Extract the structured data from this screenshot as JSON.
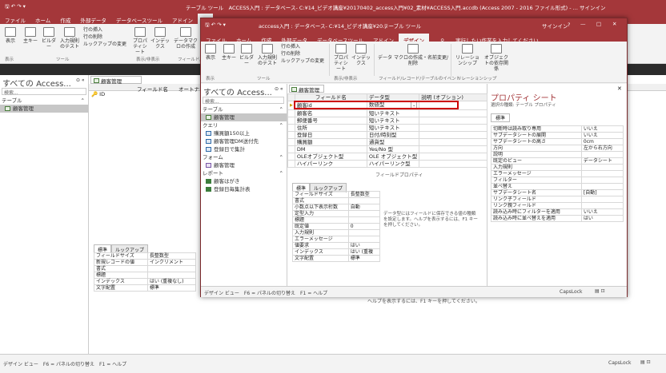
{
  "back": {
    "title": "テーブル ツール　ACCESS入門 : データベース- C:¥14_ビデオ講座¥20170402_access入門¥02_素材¥ACCESS入門.accdb (Access 2007 - 2016 ファイル形式) - ... サインイン",
    "tabs": [
      "ファイル",
      "ホーム",
      "作成",
      "外部データ",
      "データベースツール",
      "アドイン",
      "デ"
    ],
    "ribbon": {
      "view": "表示",
      "primary_key": "主キー",
      "builder": "ビルダー",
      "test_rule": "入力規則のテスト",
      "insert_row": "行の挿入",
      "delete_row": "行の削除",
      "change_lookup": "ルックアップの変更",
      "property_sheet": "プロパティシート",
      "index": "インデックス",
      "macro": "データマクロの作成",
      "group_view": "表示",
      "group_tools": "ツール",
      "group_showhide": "表示/非表示",
      "group_field": "フィールド/"
    },
    "nav_title": "すべての Access...",
    "search_placeholder": "検索...",
    "nav_section": "テーブル",
    "nav_item": "顧客管理",
    "doc_tab": "顧客管理",
    "col_field": "フィールド名",
    "col_type": "オートナ",
    "first_row": "ID",
    "field_props": [
      [
        "フィールドサイズ",
        "長整数型"
      ],
      [
        "新規レコードの値",
        "インクリメント"
      ],
      [
        "書式",
        ""
      ],
      [
        "標題",
        ""
      ],
      [
        "インデックス",
        "はい (重複なし)"
      ],
      [
        "文字配置",
        "標準"
      ]
    ],
    "prop_tabs": [
      "標準",
      "ルックアップ"
    ],
    "status_left": "デザイン ビュー　F6 = パネルの切り替え　F1 = ヘルプ",
    "status_right": "CapsLock",
    "help_text": "ヘルプを表示するには、F1 キーを押してください。"
  },
  "front": {
    "title": "acccess入門 : データベース- C:¥14_ビデオ講座¥20...",
    "context": "テーブル ツール",
    "signin": "サインイン",
    "tabs": [
      "ファイル",
      "ホーム",
      "作成",
      "外部データ",
      "データベースツール",
      "アドイン",
      "デザイン"
    ],
    "tell_me": "実行したい作業を入力してください",
    "ribbon": {
      "view": "表示",
      "primary_key": "主キー",
      "builder": "ビルダー",
      "test_rule": "入力規則のテスト",
      "insert_row": "行の挿入",
      "delete_row": "行の削除",
      "change_lookup": "ルックアップの変更",
      "property_sheet": "プロパティシート",
      "index": "インデックス",
      "macro": "データ マクロの作成・名前変更/削除",
      "relationship": "リレーションシップ",
      "object_dep": "オブジェクトの依存関係",
      "group_view": "表示",
      "group_tools": "ツール",
      "group_showhide": "表示/非表示",
      "group_event": "フィールド/レコード/テーブルのイベント",
      "group_rel": "リレーションシップ"
    },
    "nav_title": "すべての Access...",
    "search_placeholder": "検索...",
    "nav_sections": [
      {
        "name": "テーブル",
        "items": [
          {
            "label": "顧客管理",
            "kind": "table",
            "selected": true
          }
        ]
      },
      {
        "name": "クエリ",
        "items": [
          {
            "label": "購買額150以上",
            "kind": "query"
          },
          {
            "label": "顧客管理DM送付先",
            "kind": "query"
          },
          {
            "label": "登録日で集計",
            "kind": "query"
          }
        ]
      },
      {
        "name": "フォーム",
        "items": [
          {
            "label": "顧客管理",
            "kind": "form"
          }
        ]
      },
      {
        "name": "レポート",
        "items": [
          {
            "label": "顧客はがき",
            "kind": "report"
          },
          {
            "label": "登録日毎集計表",
            "kind": "report"
          }
        ]
      }
    ],
    "doc_tab": "顧客管理",
    "grid_header": [
      "フィールド名",
      "データ型",
      "説明 (オプション)"
    ],
    "rows": [
      [
        "顧客id",
        "数値型"
      ],
      [
        "顧客名",
        "短いテキスト"
      ],
      [
        "郵便番号",
        "短いテキスト"
      ],
      [
        "住所",
        "短いテキスト"
      ],
      [
        "登録日",
        "日付/時刻型"
      ],
      [
        "購買額",
        "通貨型"
      ],
      [
        "DM",
        "Yes/No 型"
      ],
      [
        "OLEオブジェクト型",
        "OLE オブジェクト型"
      ],
      [
        "ハイパーリンク",
        "ハイパーリンク型"
      ]
    ],
    "field_props_label": "フィールドプロパティ",
    "prop_tabs": [
      "標準",
      "ルックアップ"
    ],
    "field_props": [
      [
        "フィールドサイズ",
        "長整数型"
      ],
      [
        "書式",
        ""
      ],
      [
        "小数点以下表示桁数",
        "自動"
      ],
      [
        "定型入力",
        ""
      ],
      [
        "標題",
        ""
      ],
      [
        "既定値",
        "0"
      ],
      [
        "入力規則",
        ""
      ],
      [
        "エラーメッセージ",
        ""
      ],
      [
        "値要求",
        "はい"
      ],
      [
        "インデックス",
        "はい (重複"
      ],
      [
        "文字配置",
        "標準"
      ]
    ],
    "help_text": "データ型にはフィールドに保存できる値の種類を設定します。ヘルプを表示するには、F1 キーを押してください。",
    "status_left": "デザイン ビュー　F6 = パネルの切り替え　F1 = ヘルプ",
    "status_right": "CapsLock",
    "win_min": "—",
    "win_max": "□",
    "win_close": "✕"
  },
  "propsheet": {
    "title": "プロパティ シート",
    "subtitle": "選択の種類: テーブル プロパティ",
    "tab": "標準",
    "rows": [
      [
        "切断時は読み取り専用",
        "いいえ"
      ],
      [
        "サブデータシートの展開",
        "いいえ"
      ],
      [
        "サブデータシートの高さ",
        "0cm"
      ],
      [
        "方向",
        "左から右方向"
      ],
      [
        "説明",
        ""
      ],
      [
        "既定のビュー",
        "データシート"
      ],
      [
        "入力規則",
        ""
      ],
      [
        "エラーメッセージ",
        ""
      ],
      [
        "フィルター",
        ""
      ],
      [
        "並べ替え",
        ""
      ],
      [
        "サブデータシート名",
        "[自動]"
      ],
      [
        "リンク子フィールド",
        ""
      ],
      [
        "リンク親フィールド",
        ""
      ],
      [
        "読み込み時にフィルターを適用",
        "いいえ"
      ],
      [
        "読み込み時に並べ替えを適用",
        "はい"
      ]
    ]
  },
  "colors": {
    "accent": "#a4373a",
    "highlight": "#cc0000"
  }
}
